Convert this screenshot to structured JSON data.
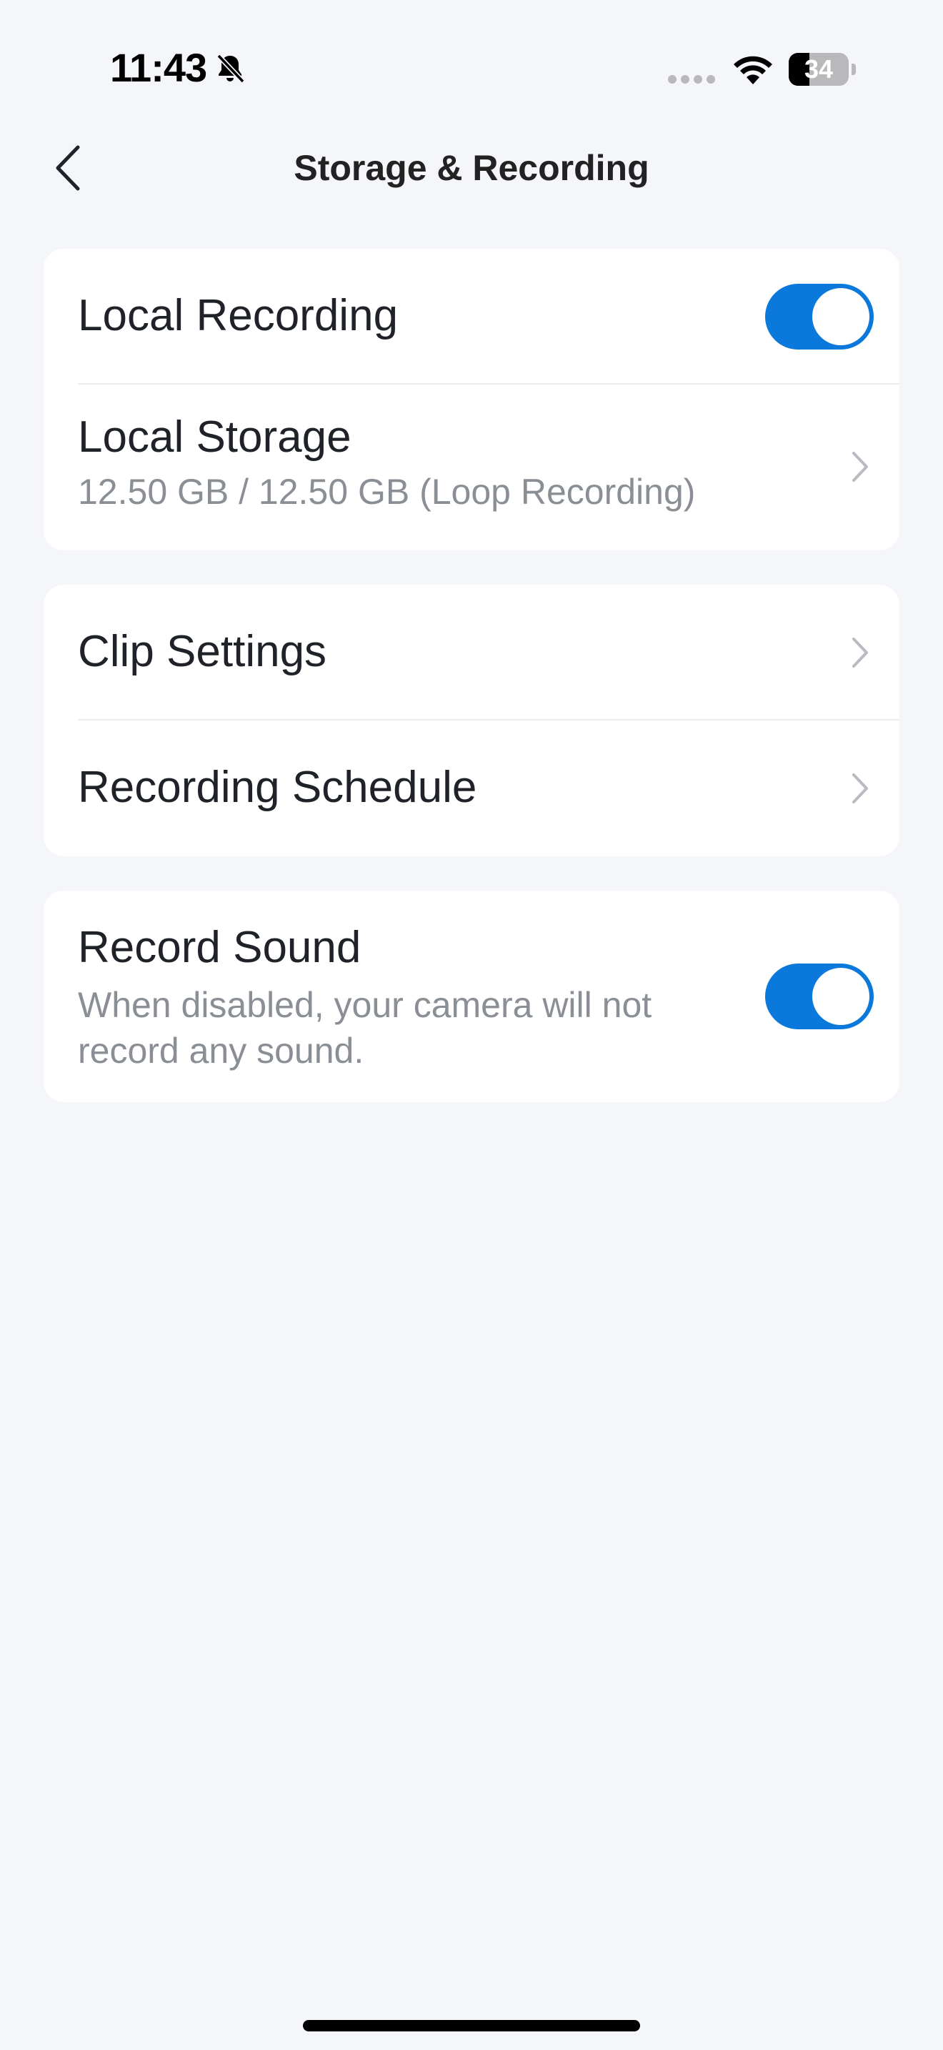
{
  "status_bar": {
    "time": "11:43",
    "battery": "34",
    "battery_level": 0.34
  },
  "header": {
    "title": "Storage & Recording"
  },
  "card_recording": {
    "local_recording": {
      "label": "Local Recording",
      "enabled": true
    },
    "local_storage": {
      "label": "Local Storage",
      "detail": "12.50 GB / 12.50 GB (Loop Recording)"
    }
  },
  "card_clips": {
    "clip_settings": {
      "label": "Clip Settings"
    },
    "recording_schedule": {
      "label": "Recording Schedule"
    }
  },
  "card_sound": {
    "record_sound": {
      "label": "Record Sound",
      "description": "When disabled, your camera will not record any sound.",
      "enabled": true
    }
  },
  "colors": {
    "accent": "#0a79db",
    "background": "#f4f6fa",
    "card": "#ffffff",
    "secondary_text": "#8a8e95"
  },
  "icons": [
    "back-chevron-icon",
    "bell-slash-icon",
    "cellular-signal-icon",
    "wifi-icon",
    "battery-icon",
    "chevron-right-icon"
  ]
}
